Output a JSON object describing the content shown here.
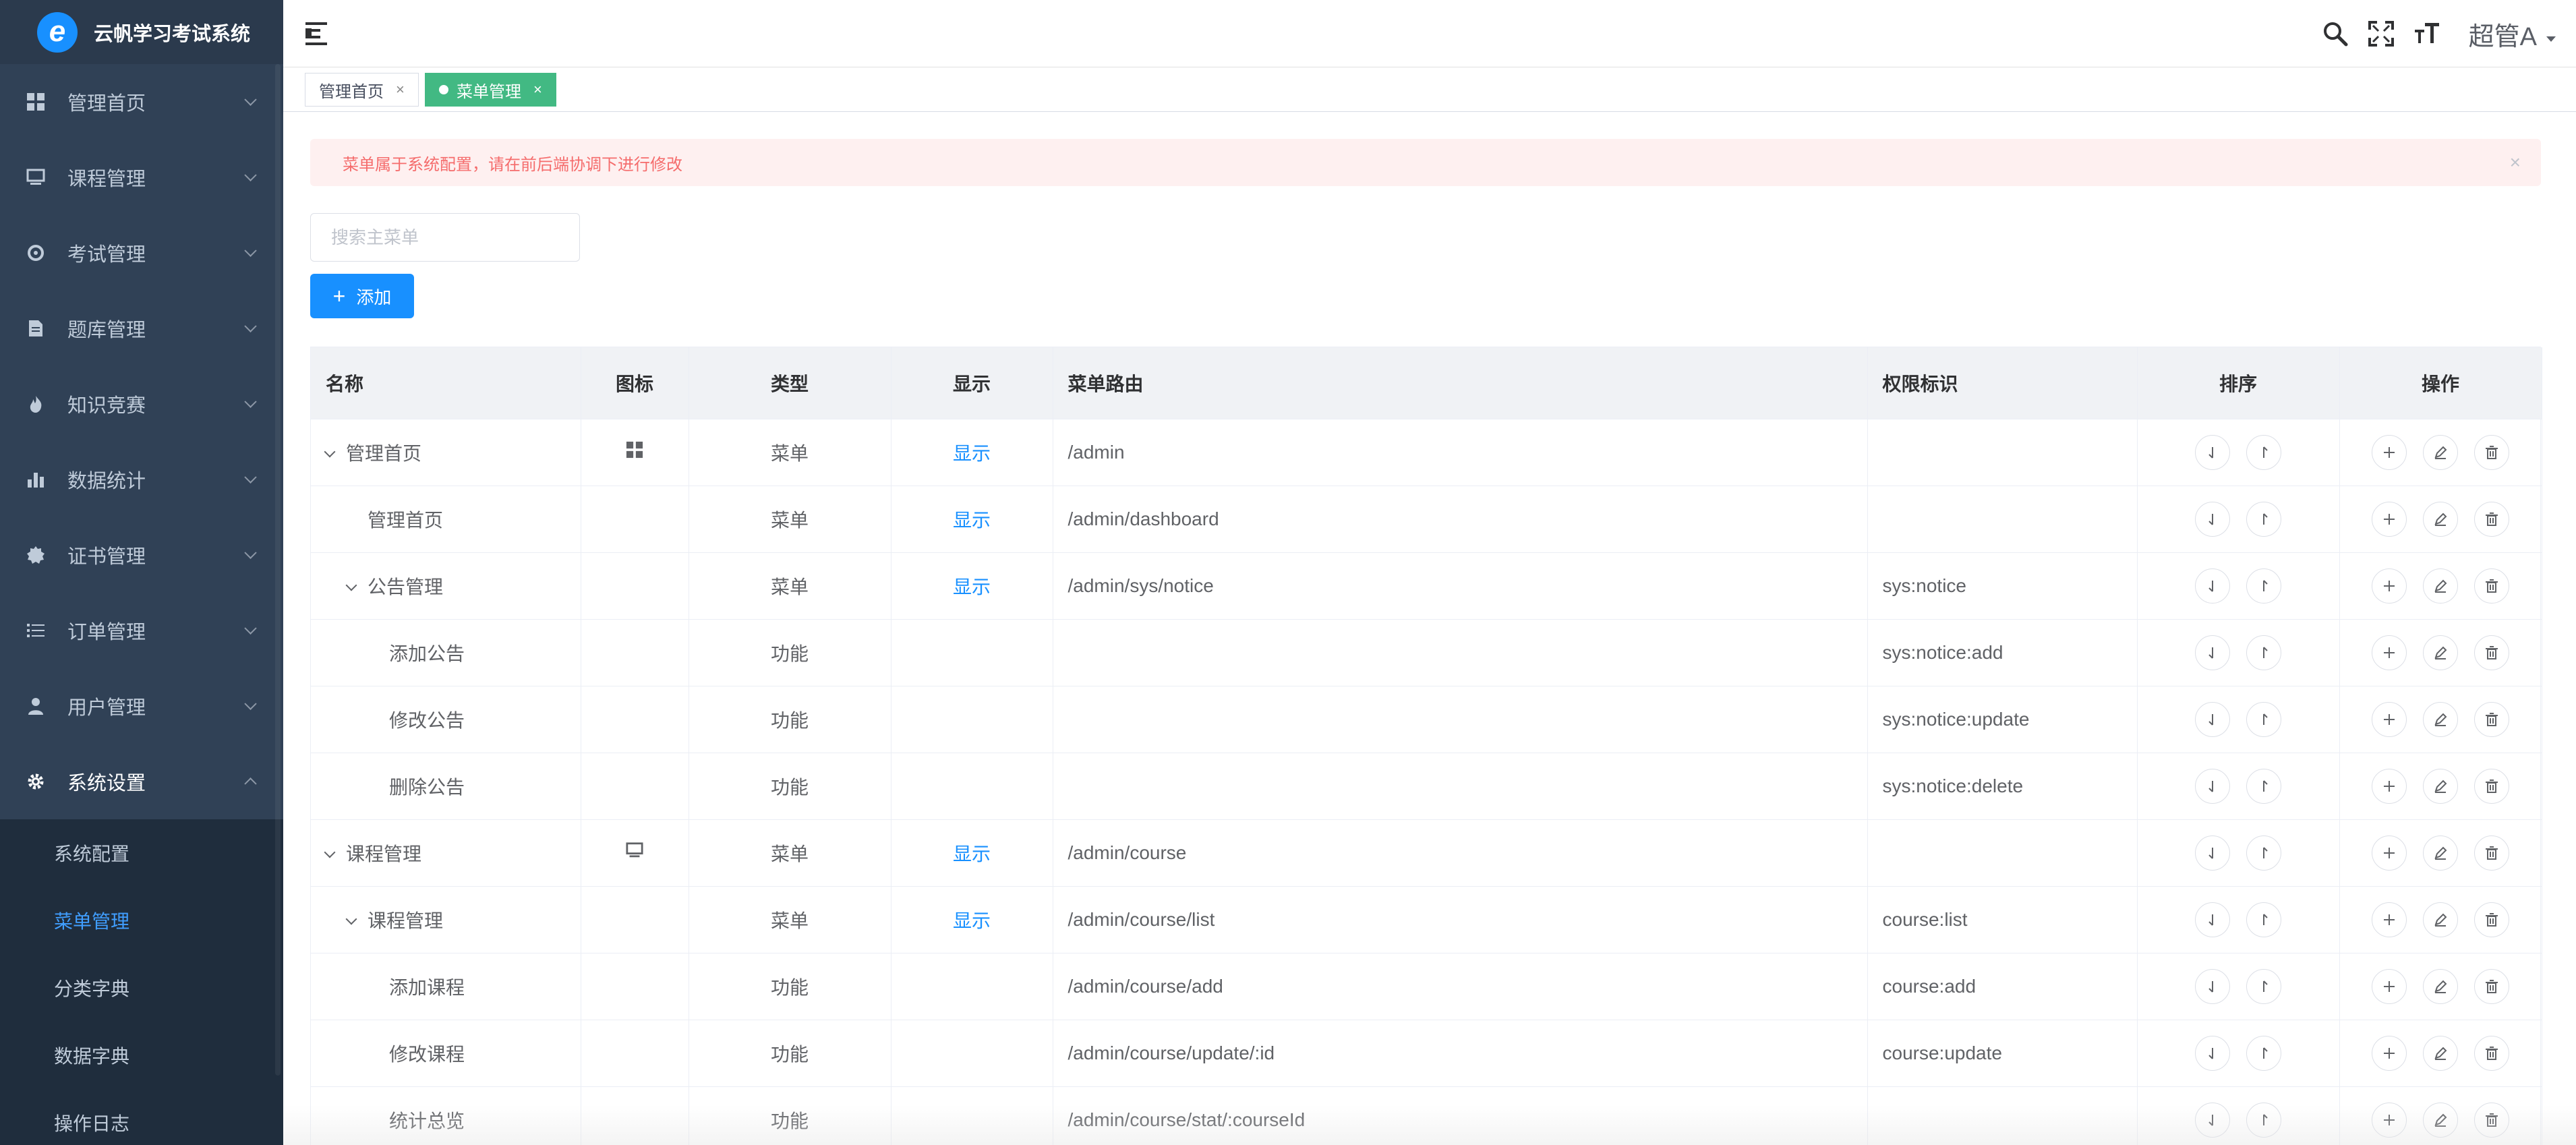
{
  "app": {
    "title": "云帆学习考试系统"
  },
  "sidebar": {
    "items": [
      {
        "label": "管理首页",
        "icon": "dashboard-icon"
      },
      {
        "label": "课程管理",
        "icon": "monitor-icon"
      },
      {
        "label": "考试管理",
        "icon": "target-icon"
      },
      {
        "label": "题库管理",
        "icon": "document-icon"
      },
      {
        "label": "知识竞赛",
        "icon": "fire-icon"
      },
      {
        "label": "数据统计",
        "icon": "bar-chart-icon"
      },
      {
        "label": "证书管理",
        "icon": "badge-icon"
      },
      {
        "label": "订单管理",
        "icon": "list-icon"
      },
      {
        "label": "用户管理",
        "icon": "user-icon"
      },
      {
        "label": "系统设置",
        "icon": "gear-icon"
      }
    ],
    "submenu": [
      {
        "label": "系统配置"
      },
      {
        "label": "菜单管理"
      },
      {
        "label": "分类字典"
      },
      {
        "label": "数据字典"
      },
      {
        "label": "操作日志"
      }
    ]
  },
  "navbar": {
    "user": "超管A"
  },
  "tags": [
    {
      "label": "管理首页",
      "close": "×"
    },
    {
      "label": "菜单管理",
      "close": "×"
    }
  ],
  "alert": {
    "text": "菜单属于系统配置，请在前后端协调下进行修改",
    "close": "×"
  },
  "search": {
    "placeholder": "搜索主菜单"
  },
  "add_button": {
    "label": "添加",
    "plus": "+"
  },
  "table": {
    "headers": {
      "name": "名称",
      "icon": "图标",
      "type": "类型",
      "display": "显示",
      "path": "菜单路由",
      "perm": "权限标识",
      "sort": "排序",
      "ops": "操作"
    },
    "rows": [
      {
        "name": "管理首页",
        "icon": "dashboard-icon",
        "type": "菜单",
        "display": "显示",
        "path": "/admin",
        "perm": ""
      },
      {
        "name": "管理首页",
        "icon": "",
        "type": "菜单",
        "display": "显示",
        "path": "/admin/dashboard",
        "perm": ""
      },
      {
        "name": "公告管理",
        "icon": "",
        "type": "菜单",
        "display": "显示",
        "path": "/admin/sys/notice",
        "perm": "sys:notice"
      },
      {
        "name": "添加公告",
        "icon": "",
        "type": "功能",
        "display": "",
        "path": "",
        "perm": "sys:notice:add"
      },
      {
        "name": "修改公告",
        "icon": "",
        "type": "功能",
        "display": "",
        "path": "",
        "perm": "sys:notice:update"
      },
      {
        "name": "删除公告",
        "icon": "",
        "type": "功能",
        "display": "",
        "path": "",
        "perm": "sys:notice:delete"
      },
      {
        "name": "课程管理",
        "icon": "monitor-icon",
        "type": "菜单",
        "display": "显示",
        "path": "/admin/course",
        "perm": ""
      },
      {
        "name": "课程管理",
        "icon": "",
        "type": "菜单",
        "display": "显示",
        "path": "/admin/course/list",
        "perm": "course:list"
      },
      {
        "name": "添加课程",
        "icon": "",
        "type": "功能",
        "display": "",
        "path": "/admin/course/add",
        "perm": "course:add"
      },
      {
        "name": "修改课程",
        "icon": "",
        "type": "功能",
        "display": "",
        "path": "/admin/course/update/:id",
        "perm": "course:update"
      },
      {
        "name": "统计总览",
        "icon": "",
        "type": "功能",
        "display": "",
        "path": "/admin/course/stat/:courseId",
        "perm": ""
      }
    ]
  }
}
